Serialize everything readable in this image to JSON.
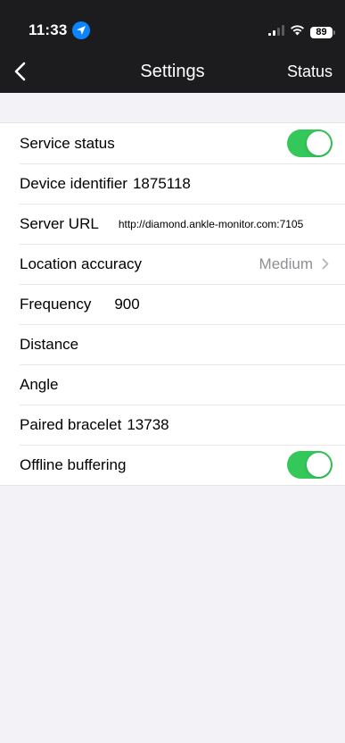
{
  "status_bar": {
    "time": "11:33",
    "battery": "89"
  },
  "nav": {
    "title": "Settings",
    "status_label": "Status"
  },
  "settings": {
    "service_status_label": "Service status",
    "device_identifier_label": "Device identifier",
    "device_identifier_value": "1875118",
    "server_url_label": "Server URL",
    "server_url_value": "http://diamond.ankle-monitor.com:7105",
    "location_accuracy_label": "Location accuracy",
    "location_accuracy_value": "Medium",
    "frequency_label": "Frequency",
    "frequency_value": "900",
    "distance_label": "Distance",
    "angle_label": "Angle",
    "paired_bracelet_label": "Paired bracelet",
    "paired_bracelet_value": "13738",
    "offline_buffering_label": "Offline buffering"
  },
  "colors": {
    "toggle_on": "#34c759",
    "header_bg": "#1c1c1e",
    "page_bg": "#f2f2f7",
    "location_badge": "#0a84ff"
  },
  "icons": {
    "location": "location-arrow-icon",
    "signal": "cellular-signal-icon",
    "wifi": "wifi-icon",
    "battery": "battery-icon",
    "back": "chevron-left-icon",
    "disclosure": "chevron-right-icon"
  }
}
